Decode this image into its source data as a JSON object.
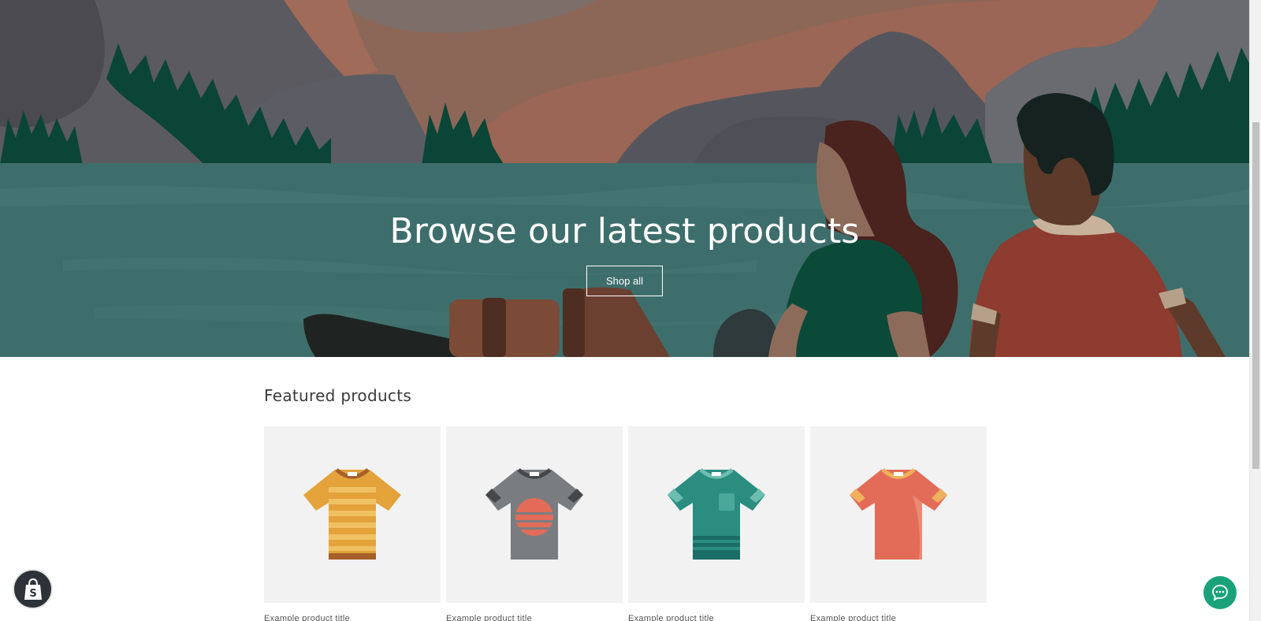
{
  "hero": {
    "title": "Browse our latest products",
    "button_label": "Shop all"
  },
  "featured": {
    "heading": "Featured products",
    "products": [
      {
        "title": "Example product title",
        "image": "orange-striped-tshirt-icon",
        "color": "#e3a23a"
      },
      {
        "title": "Example product title",
        "image": "gray-sunset-tshirt-icon",
        "color": "#7a7d80"
      },
      {
        "title": "Example product title",
        "image": "teal-pocket-tshirt-icon",
        "color": "#2a8d80"
      },
      {
        "title": "Example product title",
        "image": "coral-tshirt-icon",
        "color": "#e26c57"
      }
    ]
  },
  "floating": {
    "shop_badge_icon": "shopify-bag-icon",
    "chat_icon": "chat-bubble-icon"
  },
  "colors": {
    "hero_water": "#3e6e6b",
    "chat_button": "#1aa37a",
    "card_background": "#f2f2f2"
  }
}
